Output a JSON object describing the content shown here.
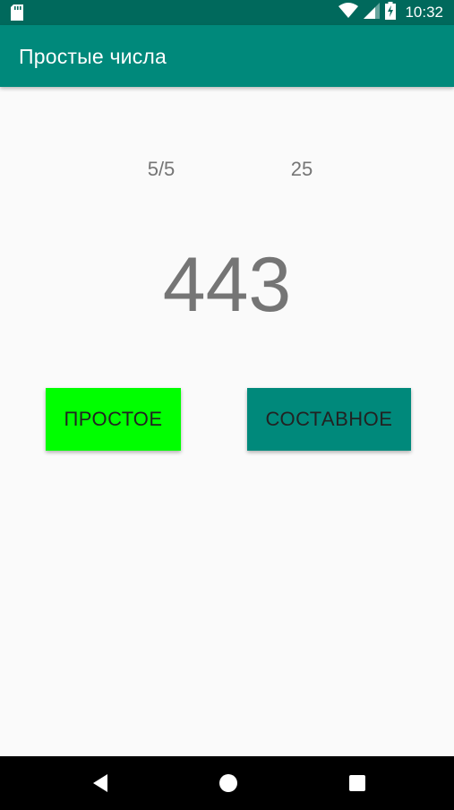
{
  "status_bar": {
    "time": "10:32",
    "icons": [
      "sd-card-icon",
      "wifi-icon",
      "signal-icon",
      "battery-icon"
    ]
  },
  "app_bar": {
    "title": "Простые числа"
  },
  "game": {
    "score": "5/5",
    "timer": "25",
    "number": "443"
  },
  "buttons": {
    "prime_label": "ПРОСТОЕ",
    "composite_label": "СОСТАВНОЕ"
  },
  "nav_bar": {
    "icons": [
      "back-icon",
      "home-icon",
      "recents-icon"
    ]
  },
  "colors": {
    "status_bar": "#00695c",
    "app_bar": "#00897b",
    "prime_button": "#00ff00",
    "composite_button": "#00897b",
    "text_gray": "#757575"
  }
}
